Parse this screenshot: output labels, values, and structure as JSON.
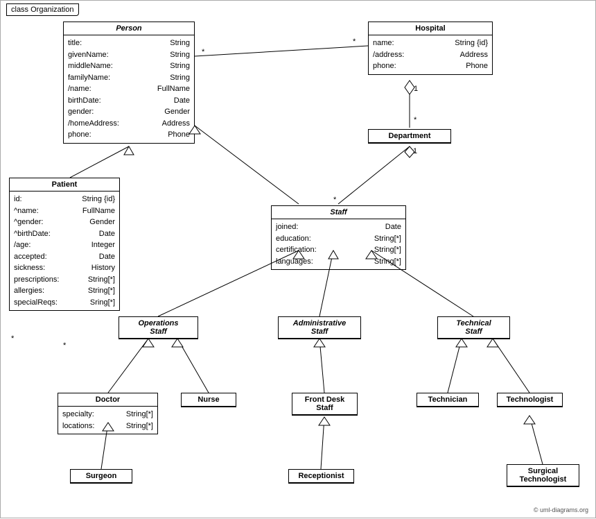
{
  "diagram": {
    "title": "class Organization",
    "classes": {
      "person": {
        "name": "Person",
        "italic": true,
        "attrs": [
          {
            "name": "title:",
            "type": "String"
          },
          {
            "name": "givenName:",
            "type": "String"
          },
          {
            "name": "middleName:",
            "type": "String"
          },
          {
            "name": "familyName:",
            "type": "String"
          },
          {
            "name": "/name:",
            "type": "FullName"
          },
          {
            "name": "birthDate:",
            "type": "Date"
          },
          {
            "name": "gender:",
            "type": "Gender"
          },
          {
            "name": "/homeAddress:",
            "type": "Address"
          },
          {
            "name": "phone:",
            "type": "Phone"
          }
        ]
      },
      "hospital": {
        "name": "Hospital",
        "italic": false,
        "attrs": [
          {
            "name": "name:",
            "type": "String {id}"
          },
          {
            "name": "/address:",
            "type": "Address"
          },
          {
            "name": "phone:",
            "type": "Phone"
          }
        ]
      },
      "department": {
        "name": "Department",
        "italic": false,
        "attrs": []
      },
      "staff": {
        "name": "Staff",
        "italic": true,
        "attrs": [
          {
            "name": "joined:",
            "type": "Date"
          },
          {
            "name": "education:",
            "type": "String[*]"
          },
          {
            "name": "certification:",
            "type": "String[*]"
          },
          {
            "name": "languages:",
            "type": "String[*]"
          }
        ]
      },
      "patient": {
        "name": "Patient",
        "italic": false,
        "attrs": [
          {
            "name": "id:",
            "type": "String {id}"
          },
          {
            "name": "^name:",
            "type": "FullName"
          },
          {
            "name": "^gender:",
            "type": "Gender"
          },
          {
            "name": "^birthDate:",
            "type": "Date"
          },
          {
            "name": "/age:",
            "type": "Integer"
          },
          {
            "name": "accepted:",
            "type": "Date"
          },
          {
            "name": "sickness:",
            "type": "History"
          },
          {
            "name": "prescriptions:",
            "type": "String[*]"
          },
          {
            "name": "allergies:",
            "type": "String[*]"
          },
          {
            "name": "specialReqs:",
            "type": "Sring[*]"
          }
        ]
      },
      "operations_staff": {
        "name": "Operations\nStaff",
        "italic": true,
        "attrs": []
      },
      "administrative_staff": {
        "name": "Administrative\nStaff",
        "italic": true,
        "attrs": []
      },
      "technical_staff": {
        "name": "Technical\nStaff",
        "italic": true,
        "attrs": []
      },
      "doctor": {
        "name": "Doctor",
        "italic": false,
        "attrs": [
          {
            "name": "specialty:",
            "type": "String[*]"
          },
          {
            "name": "locations:",
            "type": "String[*]"
          }
        ]
      },
      "nurse": {
        "name": "Nurse",
        "italic": false,
        "attrs": []
      },
      "front_desk_staff": {
        "name": "Front Desk\nStaff",
        "italic": false,
        "attrs": []
      },
      "technician": {
        "name": "Technician",
        "italic": false,
        "attrs": []
      },
      "technologist": {
        "name": "Technologist",
        "italic": false,
        "attrs": []
      },
      "surgeon": {
        "name": "Surgeon",
        "italic": false,
        "attrs": []
      },
      "receptionist": {
        "name": "Receptionist",
        "italic": false,
        "attrs": []
      },
      "surgical_technologist": {
        "name": "Surgical\nTechnologist",
        "italic": false,
        "attrs": []
      }
    },
    "copyright": "© uml-diagrams.org"
  }
}
